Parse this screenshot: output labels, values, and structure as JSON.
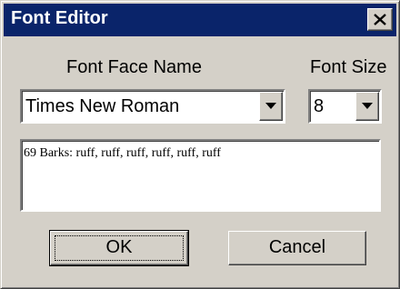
{
  "window": {
    "title": "Font Editor",
    "close_icon": "close-icon"
  },
  "labels": {
    "font_face_name": "Font Face Name",
    "font_size": "Font Size"
  },
  "font_face": {
    "selected": "Times New Roman",
    "arrow_icon": "chevron-down-icon"
  },
  "font_size": {
    "selected": "8",
    "arrow_icon": "chevron-down-icon"
  },
  "preview": {
    "text": "69 Barks: ruff, ruff, ruff, ruff, ruff, ruff"
  },
  "buttons": {
    "ok": "OK",
    "cancel": "Cancel"
  },
  "colors": {
    "titlebar": "#0a246a",
    "face": "#d4d0c8"
  }
}
